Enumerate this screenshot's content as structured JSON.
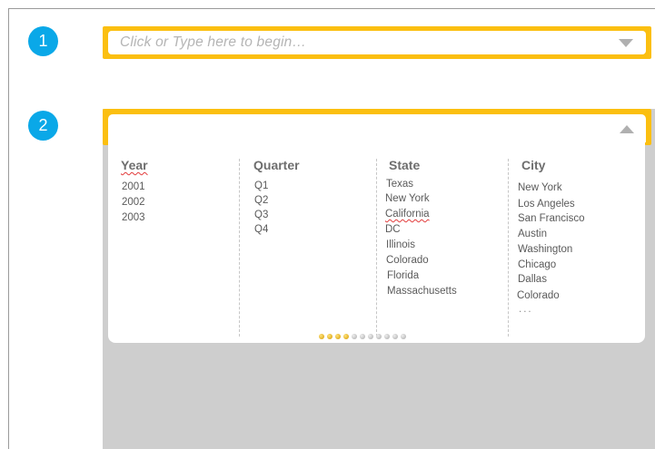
{
  "steps": [
    "1",
    "2"
  ],
  "search": {
    "placeholder": "Click or Type here to begin…"
  },
  "columns": [
    {
      "header": "Year",
      "items": [
        "2001",
        "2002",
        "2003"
      ]
    },
    {
      "header": "Quarter",
      "items": [
        "Q1",
        "Q2",
        "Q3",
        "Q4"
      ]
    },
    {
      "header": "State",
      "items": [
        "Texas",
        "New York",
        "California",
        "DC",
        "Illinois",
        "Colorado",
        "Florida",
        "Massachusetts"
      ]
    },
    {
      "header": "City",
      "items": [
        "New York",
        "Los Angeles",
        "San Francisco",
        "Austin",
        "Washington",
        "Chicago",
        "Dallas",
        "Colorado",
        "..."
      ]
    }
  ],
  "pagination": {
    "total": 11,
    "active": [
      0,
      1,
      2,
      3
    ]
  },
  "colors": {
    "accent": "#fbbf10",
    "badge": "#0aa8e8",
    "panel_bg": "#cecece"
  }
}
